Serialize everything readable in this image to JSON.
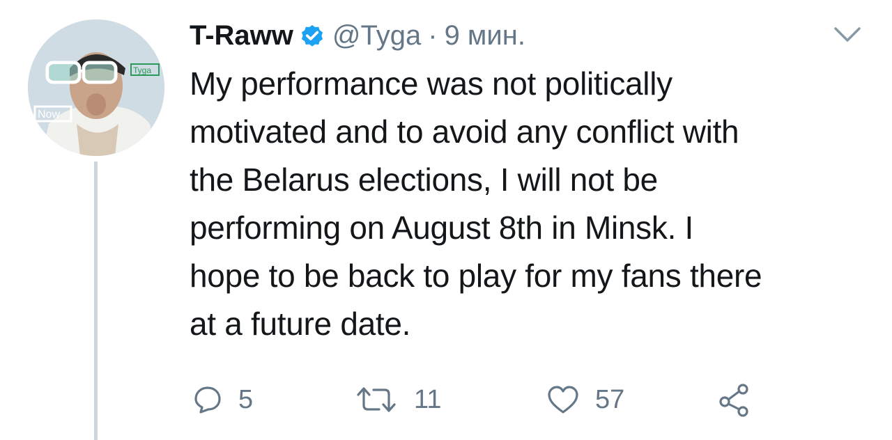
{
  "tweet": {
    "author": {
      "display_name": "T-Raww",
      "handle": "@Tyga",
      "separator": "·",
      "time": "9 мин.",
      "verified": true,
      "avatar": {
        "overlay_label_left": "Now",
        "overlay_label_right": "Tyga"
      }
    },
    "text_lines": [
      "My performance was not politically",
      "motivated and to avoid any conflict with",
      "the Belarus elections, I will not be",
      "performing on August 8th in Minsk. I",
      "hope to be back to play for my fans there",
      "at a future date."
    ],
    "actions": {
      "reply_count": "5",
      "retweet_count": "11",
      "like_count": "57"
    },
    "icons": {
      "verified": "verified-badge-icon",
      "menu": "chevron-down-icon",
      "reply": "reply-bubble-icon",
      "retweet": "retweet-icon",
      "like": "heart-icon",
      "share": "share-icon"
    },
    "colors": {
      "text": "#14171a",
      "secondary": "#657786",
      "verified": "#1da1f2",
      "thread_line": "#ccd6dd"
    }
  }
}
